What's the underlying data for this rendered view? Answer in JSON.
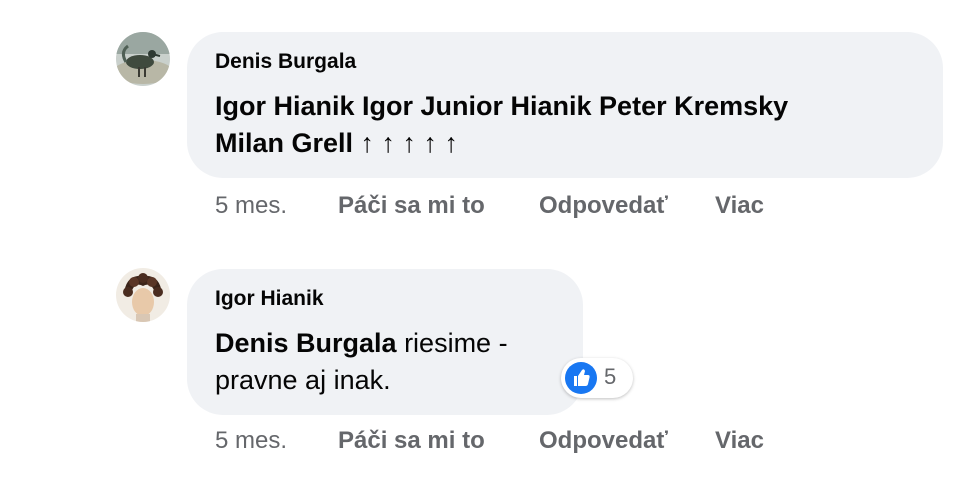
{
  "comments": [
    {
      "author": "Denis Burgala",
      "mention": "",
      "text_line1": "Igor Hianik Igor Junior Hianik Peter Kremsky",
      "text_line2": "Milan Grell ↑ ↑ ↑ ↑ ↑",
      "time": "5 mes.",
      "like_label": "Páči sa mi to",
      "reply_label": "Odpovedať",
      "more_label": "Viac",
      "avatar_icon": "peacock-photo-avatar"
    },
    {
      "author": "Igor Hianik",
      "mention": "Denis Burgala",
      "text_line1": " riesime -",
      "text_line2": "pravne aj inak.",
      "time": "5 mes.",
      "like_label": "Páči sa mi to",
      "reply_label": "Odpovedať",
      "more_label": "Viac",
      "avatar_icon": "curly-hair-photo-avatar",
      "reactions": {
        "icon": "thumbs-up-icon",
        "count": "5",
        "color": "#1877f2"
      }
    }
  ],
  "colors": {
    "bubble": "#f0f2f5",
    "text": "#050505",
    "secondary": "#65676b",
    "like_blue": "#1877f2"
  }
}
